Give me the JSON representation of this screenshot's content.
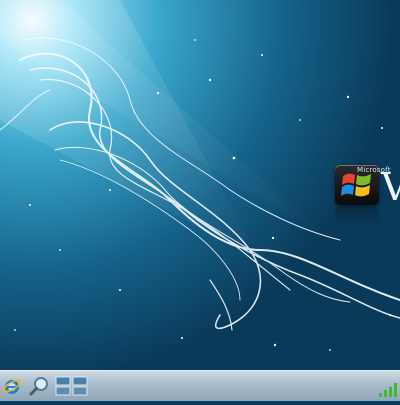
{
  "desktop": {
    "wallpaper": "windows-vista-aurora",
    "colors": {
      "background_dark": "#0b3d5c",
      "background_light": "#3fb6d8",
      "ribbon": "#e9f7ff"
    },
    "brand": {
      "small_text": "Microsoft",
      "big_text": "V",
      "logo_icon": "windows-flag-icon"
    }
  },
  "taskbar": {
    "icons": [
      {
        "name": "internet-explorer-icon"
      },
      {
        "name": "search-icon"
      },
      {
        "name": "switch-windows-icon"
      }
    ],
    "tray": {
      "network_icon": "network-signal-icon"
    }
  }
}
